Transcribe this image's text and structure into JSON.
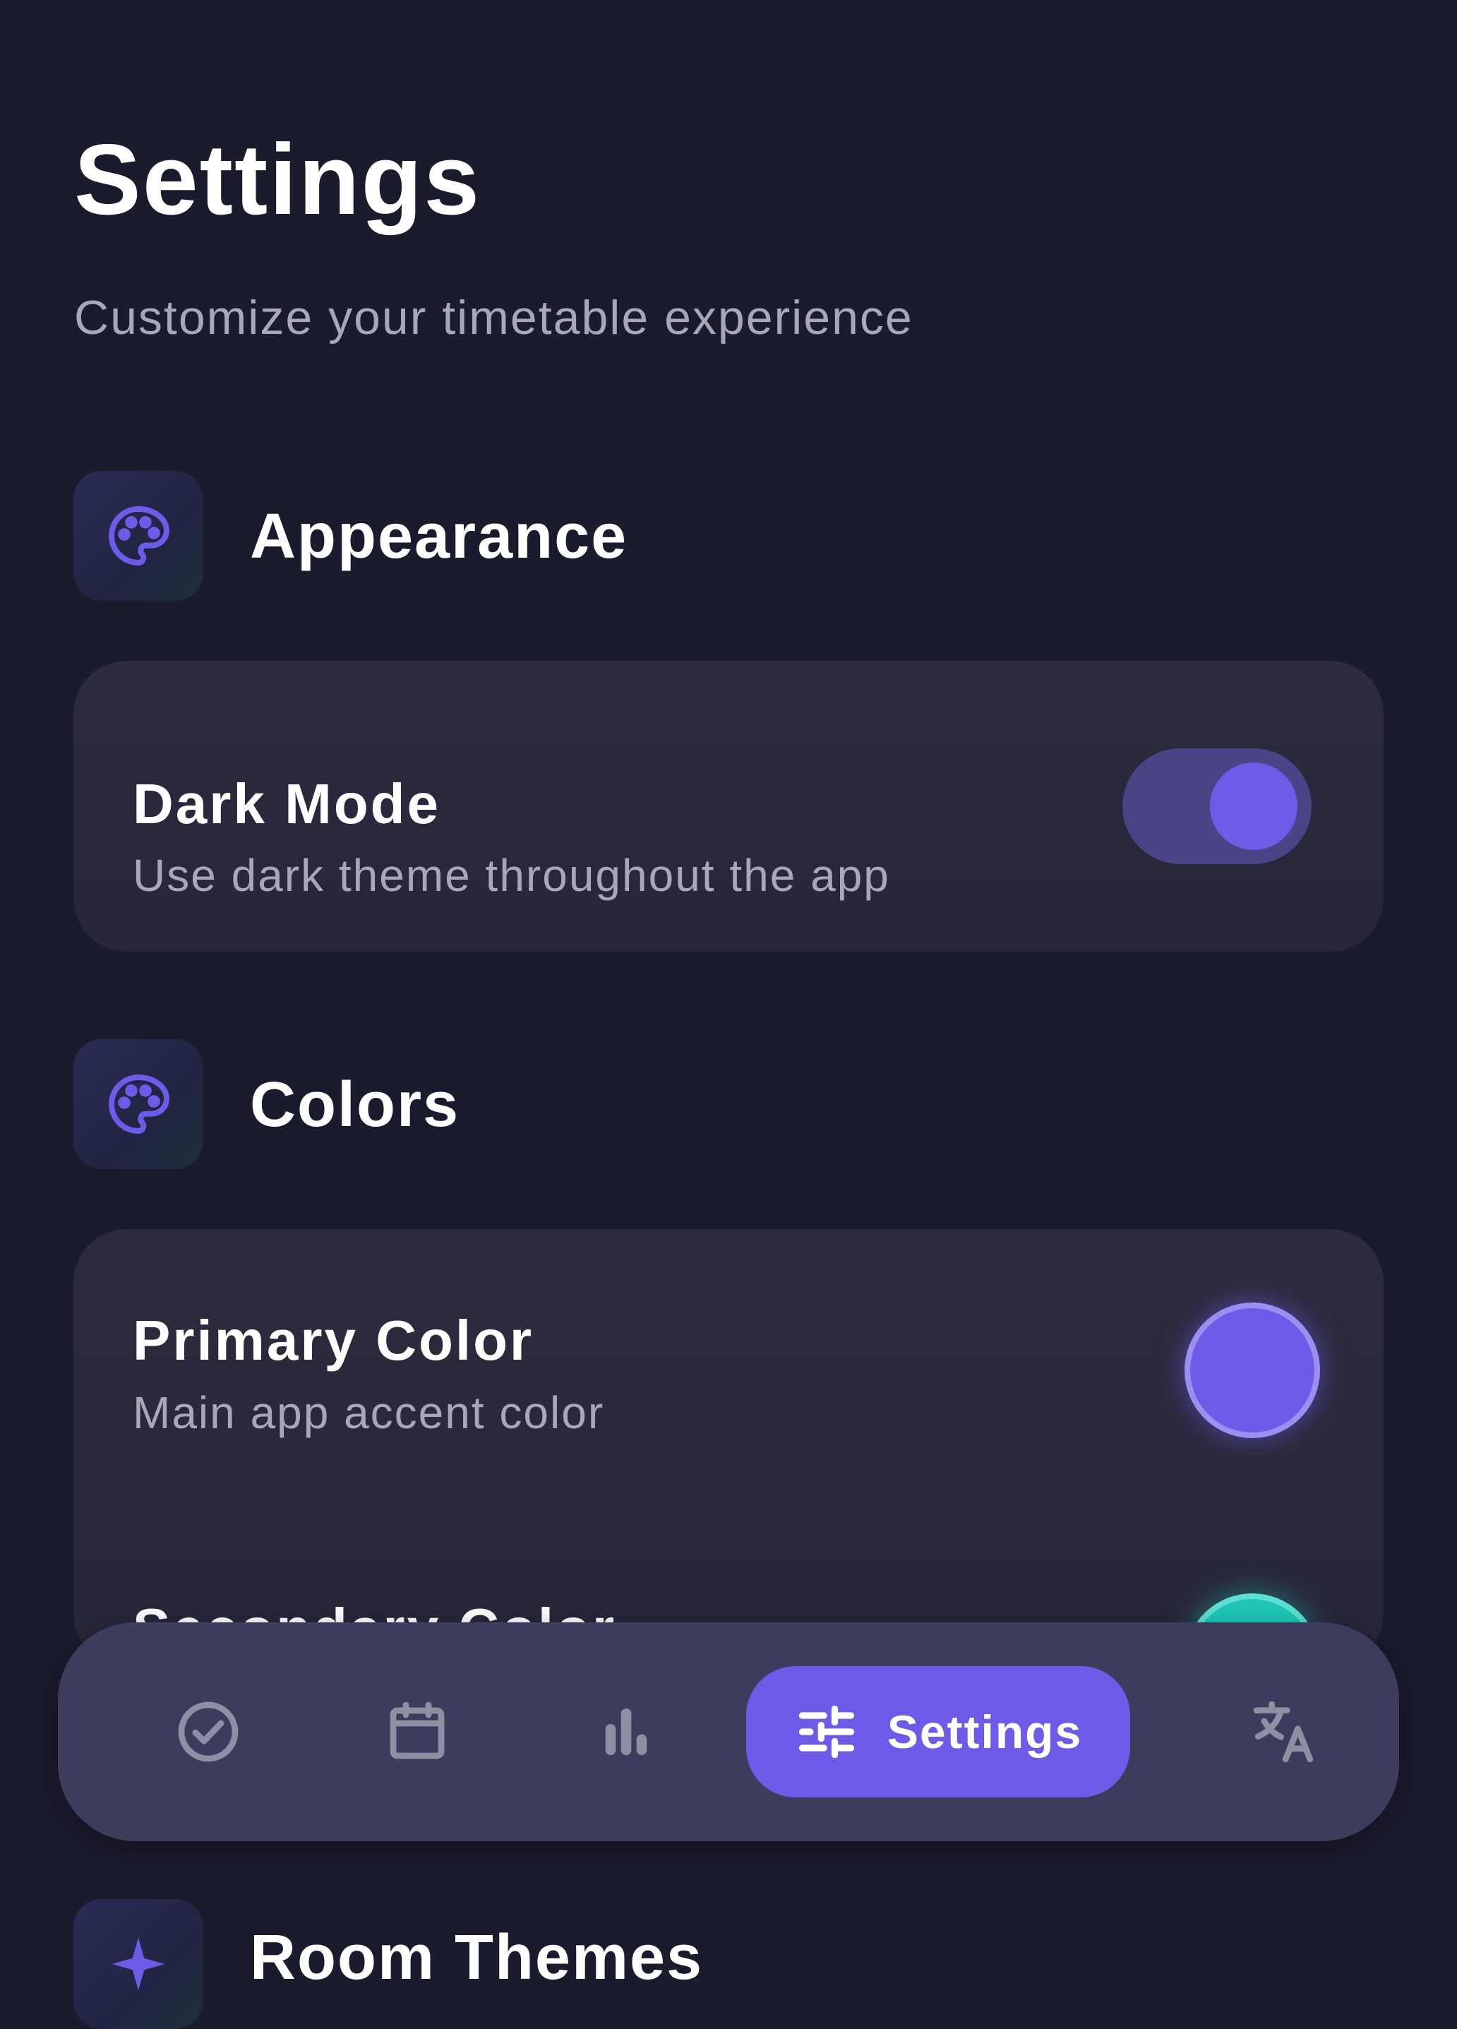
{
  "header": {
    "title": "Settings",
    "subtitle": "Customize your timetable experience"
  },
  "sections": {
    "appearance": {
      "title": "Appearance",
      "icon": "palette-icon",
      "dark_mode": {
        "title": "Dark Mode",
        "description": "Use dark theme throughout the app",
        "enabled": true
      }
    },
    "colors": {
      "title": "Colors",
      "icon": "palette-icon",
      "primary": {
        "title": "Primary Color",
        "description": "Main app accent color",
        "color": "#6c5ce7"
      },
      "secondary": {
        "title": "Secondary Color",
        "color": "#1fc8b8"
      }
    },
    "next_section": {
      "title": "Room Themes",
      "icon": "sparkle-icon"
    }
  },
  "bottom_nav": {
    "items": [
      {
        "icon": "check-circle-icon",
        "label": "Tasks"
      },
      {
        "icon": "calendar-icon",
        "label": "Timetable"
      },
      {
        "icon": "bar-chart-icon",
        "label": "Stats"
      },
      {
        "icon": "sliders-icon",
        "label": "Settings",
        "active": true
      },
      {
        "icon": "translate-icon",
        "label": "Language"
      }
    ],
    "active_label": "Settings"
  },
  "colors": {
    "background": "#1b1b2e",
    "accent": "#6c5ce7",
    "card": "#2b2a3c",
    "nav_bar": "#3e3c5c",
    "secondary_teal": "#1fc8b8"
  }
}
